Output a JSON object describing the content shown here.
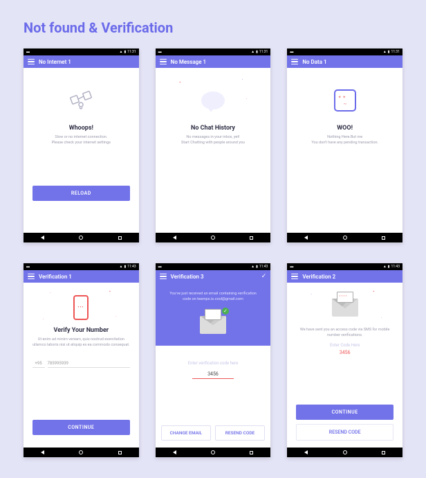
{
  "page": {
    "heading": "Not found & Verification"
  },
  "status": {
    "time": "11:31",
    "time2": "11:43"
  },
  "screens": {
    "s1": {
      "bar_title": "No Internet 1",
      "heading": "Whoops!",
      "sub1": "Slow or no internet connection.",
      "sub2": "Please check your internet settings",
      "button": "RELOAD"
    },
    "s2": {
      "bar_title": "No Message 1",
      "heading": "No Chat History",
      "sub1": "No messages in your inbox, yet!",
      "sub2": "Start Chatting with people around you"
    },
    "s3": {
      "bar_title": "No Data 1",
      "heading": "WOO!",
      "sub1": "Nothing Here.But me",
      "sub2": "You don't have any pending transaction."
    },
    "s4": {
      "bar_title": "Verification 1",
      "heading": "Verify Your Number",
      "sub": "Ut enim ad minim veniam, quis nostrud exercitation ullamco laboris nisi ut aliquip ex ea commodo consequat.",
      "prefix": "+95",
      "placeholder": "785995939",
      "button": "CONTINUE"
    },
    "s5": {
      "bar_title": "Verification 3",
      "sub": "You've just received an email containing verification code on teamps.is.cool@gmail.com",
      "code_label": "Enter verification code here",
      "code_value": "3456",
      "btn_change": "CHANGE EMAIL",
      "btn_resend": "RESEND CODE"
    },
    "s6": {
      "bar_title": "Verification 2",
      "sub": "We have sent you an access code via SMS for mobile number verifications.",
      "code_label": "Enter Code Here",
      "code_value": "3456",
      "btn_continue": "CONTINUE",
      "btn_resend": "RESEND CODE"
    }
  }
}
